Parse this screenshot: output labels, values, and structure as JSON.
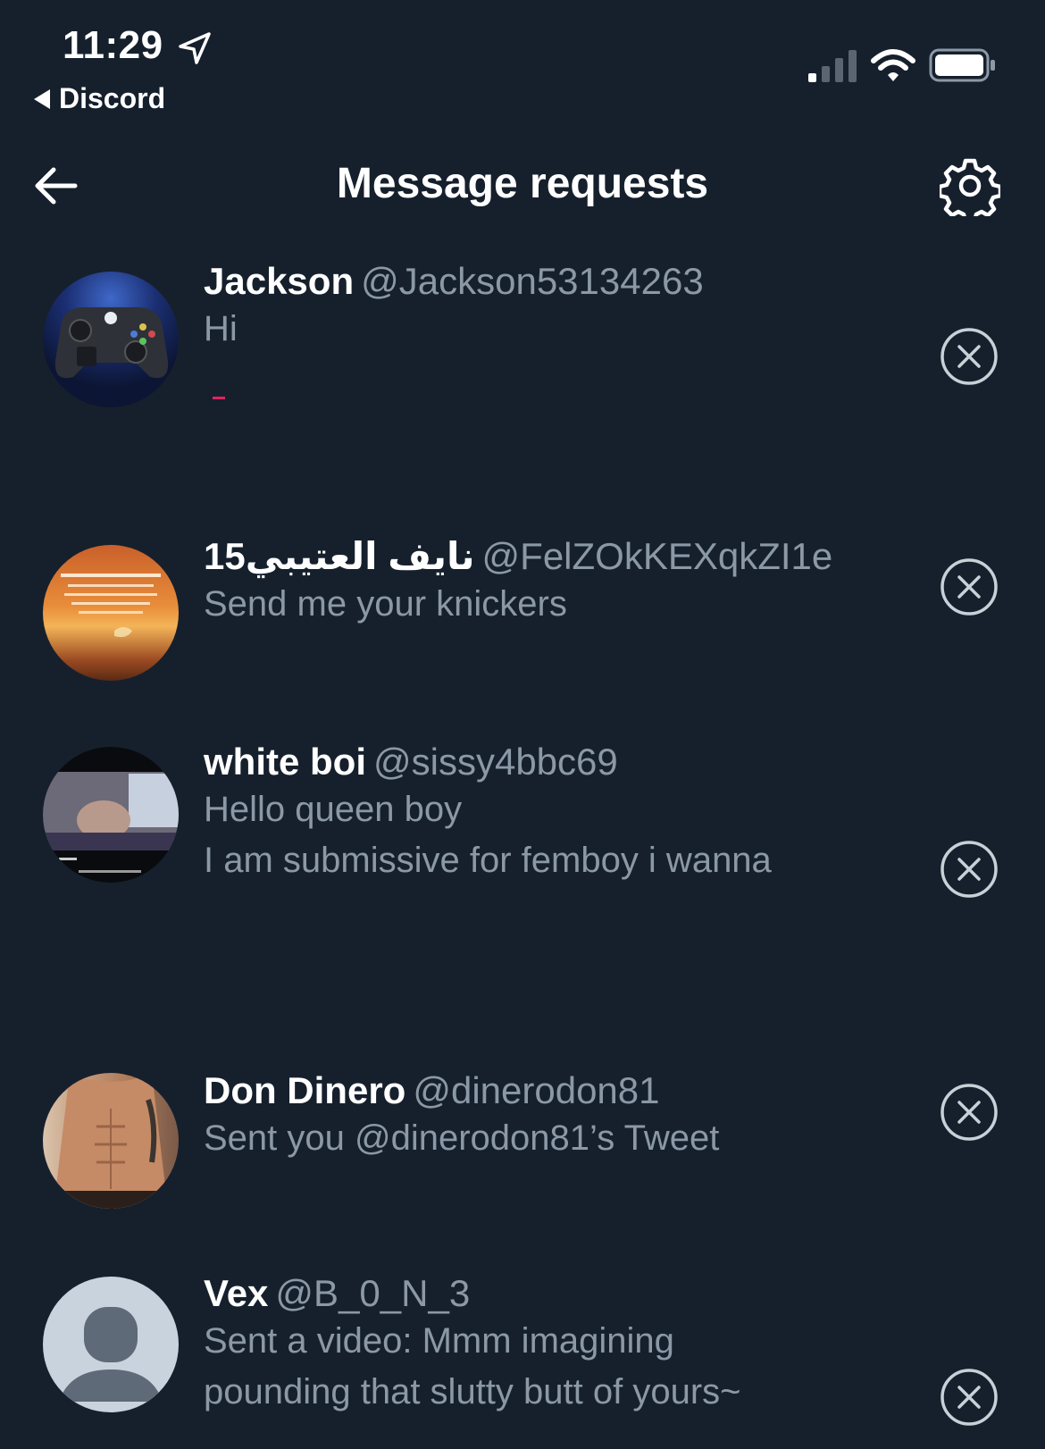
{
  "status_bar": {
    "time": "11:29",
    "back_app": "Discord",
    "icons": [
      "location-arrow-icon",
      "cellular-signal-icon",
      "wifi-icon",
      "battery-icon"
    ]
  },
  "header": {
    "title": "Message requests",
    "icons": [
      "back-arrow-icon",
      "settings-gear-icon"
    ]
  },
  "requests": [
    {
      "name": "Jackson",
      "handle": "@Jackson53134263",
      "message": [
        "Hi"
      ],
      "avatar": "controller-photo"
    },
    {
      "name": "نايف العتيبي15",
      "handle": "@FelZOkKEXqkZI1e",
      "message": [
        "Send me your knickers"
      ],
      "avatar": "sunset-photo"
    },
    {
      "name": "white boi",
      "handle": "@sissy4bbc69",
      "message": [
        "Hello queen boy",
        "I am submissive for femboy i wanna"
      ],
      "avatar": "video-thumbnail"
    },
    {
      "name": "Don Dinero",
      "handle": "@dinerodon81",
      "message": [
        "Sent you @dinerodon81’s Tweet"
      ],
      "avatar": "torso-photo"
    },
    {
      "name": "Vex",
      "handle": "@B_0_N_3",
      "message": [
        "Sent a video: Mmm imagining",
        "pounding that slutty butt of yours~"
      ],
      "avatar": "default-avatar"
    }
  ],
  "colors": {
    "background": "#16202d",
    "primary_text": "#ffffff",
    "secondary_text": "#8b98a5"
  }
}
